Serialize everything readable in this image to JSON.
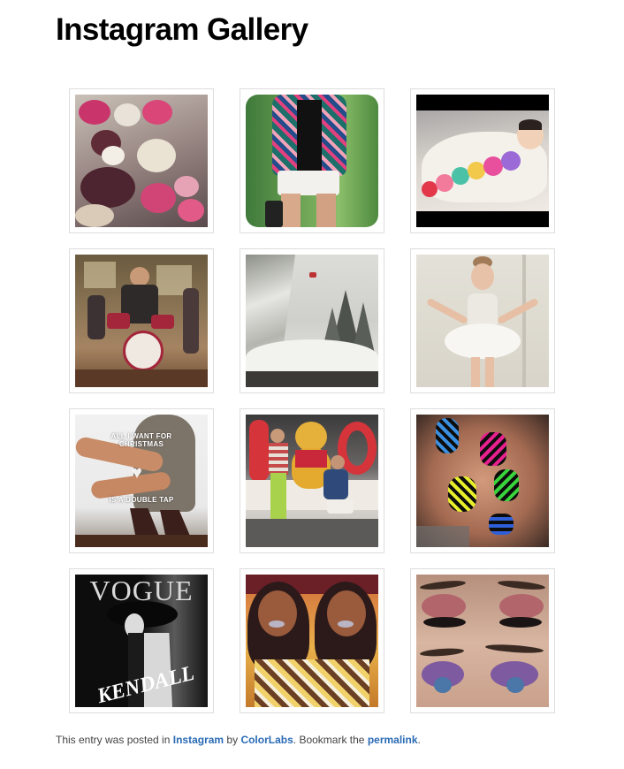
{
  "page": {
    "title": "Instagram Gallery"
  },
  "gallery": {
    "items": [
      {
        "subject": "cupcakes"
      },
      {
        "subject": "floral-jacket"
      },
      {
        "subject": "baby-with-plush-toys"
      },
      {
        "subject": "kids-drum-set"
      },
      {
        "subject": "snowboarder-in-snow"
      },
      {
        "subject": "little-ballerina"
      },
      {
        "subject": "christmas-double-tap",
        "caption_top": "ALL I WANT FOR CHRISTMAS",
        "caption_bottom": "IS A DOUBLE TAP"
      },
      {
        "subject": "winnie-the-pooh"
      },
      {
        "subject": "neon-nails"
      },
      {
        "subject": "vogue-cover",
        "masthead": "VOGUE",
        "signature": "KENDALL"
      },
      {
        "subject": "mirrored-portrait"
      },
      {
        "subject": "eye-makeup"
      }
    ]
  },
  "footer": {
    "prefix": "This entry was posted in ",
    "category": "Instagram",
    "by_text": " by ",
    "author": "ColorLabs",
    "bookmark_text": ". Bookmark the ",
    "permalink": "permalink",
    "suffix": "."
  },
  "colors": {
    "link": "#2a6bb5",
    "thumb_border": "#dddddd"
  }
}
